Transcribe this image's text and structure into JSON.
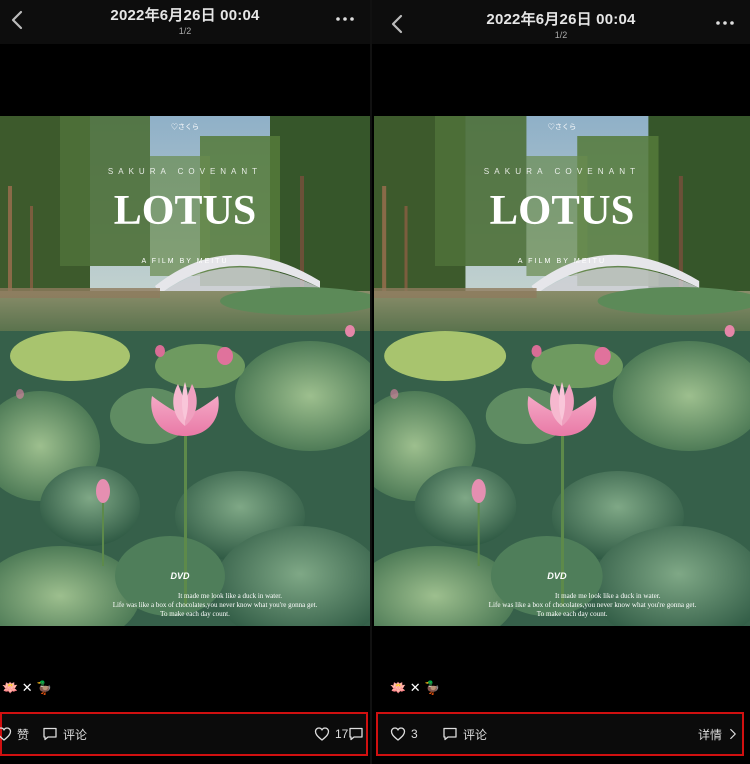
{
  "left": {
    "header": {
      "title": "2022年6月26日 00:04",
      "page": "1/2"
    },
    "poster": {
      "badge": "♡さくら",
      "series": "SAKURA COVENANT",
      "title": "LOTUS",
      "byline": "A FILM BY MEITU",
      "logo": "DVD",
      "tagline": [
        "It made me look like a duck in water.",
        "Life was like a box of chocolates,you never know what you're gonna get.",
        "To make each day count."
      ]
    },
    "caption": {
      "emoji": "🪷 ✕ 🦆"
    },
    "actions": {
      "like_label": "赞",
      "comment_label": "评论",
      "like_count": "17"
    }
  },
  "right": {
    "header": {
      "title": "2022年6月26日 00:04",
      "page": "1/2"
    },
    "poster": {
      "badge": "♡さくら",
      "series": "SAKURA COVENANT",
      "title": "LOTUS",
      "byline": "A FILM BY MEITU",
      "logo": "DVD",
      "tagline": [
        "It made me look like a duck in water.",
        "Life was like a box of chocolates,you never know what you're gonna get.",
        "To make each day count."
      ]
    },
    "caption": {
      "emoji": "🪷 ✕ 🦆"
    },
    "actions": {
      "like_count": "3",
      "comment_label": "评论",
      "details_label": "详情"
    }
  },
  "colors": {
    "highlight_border": "#d01010",
    "background": "#000000",
    "bar": "#0b0b0b"
  },
  "icons": [
    "back-arrow-icon",
    "more-icon",
    "heart-icon",
    "comment-icon",
    "chevron-right-icon"
  ]
}
